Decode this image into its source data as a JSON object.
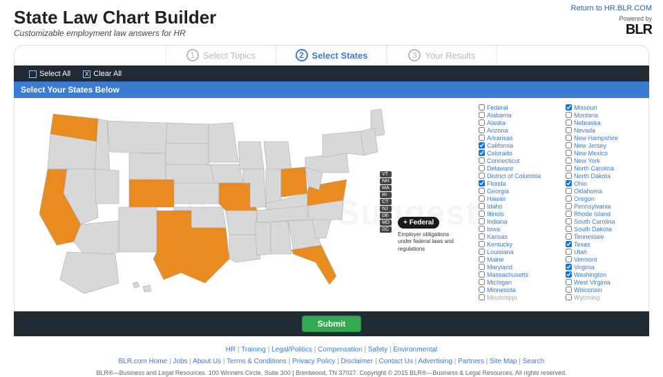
{
  "header": {
    "title": "State Law Chart Builder",
    "subtitle": "Customizable employment law answers for HR",
    "return_link": "Return to HR.BLR.COM",
    "powered_by": "Powered by",
    "brand": "BLR"
  },
  "steps": {
    "s1": {
      "num": "1",
      "label": "Select Topics"
    },
    "s2": {
      "num": "2",
      "label": "Select States"
    },
    "s3": {
      "num": "3",
      "label": "Your Results"
    }
  },
  "toolbar": {
    "select_all": "Select All",
    "clear_all": "Clear All"
  },
  "section_title": "Select Your States Below",
  "federal": {
    "pill": "+ Federal",
    "desc": "Employer obligations under federal laws and regulations"
  },
  "small_state_labels": [
    "VT",
    "NH",
    "MA",
    "RI",
    "CT",
    "NJ",
    "DE",
    "MD",
    "DC"
  ],
  "states_col1": [
    {
      "label": "Federal",
      "checked": false
    },
    {
      "label": "Alabama",
      "checked": false
    },
    {
      "label": "Alaska",
      "checked": false
    },
    {
      "label": "Arizona",
      "checked": false
    },
    {
      "label": "Arkansas",
      "checked": false
    },
    {
      "label": "California",
      "checked": true
    },
    {
      "label": "Colorado",
      "checked": true
    },
    {
      "label": "Connecticut",
      "checked": false
    },
    {
      "label": "Delaware",
      "checked": false
    },
    {
      "label": "District of Columbia",
      "checked": false
    },
    {
      "label": "Florida",
      "checked": true
    },
    {
      "label": "Georgia",
      "checked": false
    },
    {
      "label": "Hawaii",
      "checked": false
    },
    {
      "label": "Idaho",
      "checked": false
    },
    {
      "label": "Illinois",
      "checked": false
    },
    {
      "label": "Indiana",
      "checked": false
    },
    {
      "label": "Iowa",
      "checked": false
    },
    {
      "label": "Kansas",
      "checked": false
    },
    {
      "label": "Kentucky",
      "checked": false
    },
    {
      "label": "Louisiana",
      "checked": false
    },
    {
      "label": "Maine",
      "checked": false
    },
    {
      "label": "Maryland",
      "checked": false
    },
    {
      "label": "Massachusetts",
      "checked": false
    },
    {
      "label": "Michigan",
      "checked": false
    },
    {
      "label": "Minnesota",
      "checked": false
    },
    {
      "label": "Mississippi",
      "checked": false,
      "muted": true
    }
  ],
  "states_col2": [
    {
      "label": "Missouri",
      "checked": true
    },
    {
      "label": "Montana",
      "checked": false
    },
    {
      "label": "Nebraska",
      "checked": false
    },
    {
      "label": "Nevada",
      "checked": false
    },
    {
      "label": "New Hampshire",
      "checked": false
    },
    {
      "label": "New Jersey",
      "checked": false
    },
    {
      "label": "New Mexico",
      "checked": false
    },
    {
      "label": "New York",
      "checked": false
    },
    {
      "label": "North Carolina",
      "checked": false
    },
    {
      "label": "North Dakota",
      "checked": false
    },
    {
      "label": "Ohio",
      "checked": true
    },
    {
      "label": "Oklahoma",
      "checked": false
    },
    {
      "label": "Oregon",
      "checked": false
    },
    {
      "label": "Pennsylvania",
      "checked": false
    },
    {
      "label": "Rhode Island",
      "checked": false
    },
    {
      "label": "South Carolina",
      "checked": false
    },
    {
      "label": "South Dakota",
      "checked": false
    },
    {
      "label": "Tennessee",
      "checked": false
    },
    {
      "label": "Texas",
      "checked": true
    },
    {
      "label": "Utah",
      "checked": false
    },
    {
      "label": "Vermont",
      "checked": false
    },
    {
      "label": "Virginia",
      "checked": true
    },
    {
      "label": "Washington",
      "checked": true
    },
    {
      "label": "West Virginia",
      "checked": false
    },
    {
      "label": "Wisconsin",
      "checked": false
    },
    {
      "label": "Wyoming",
      "checked": false,
      "muted": true
    }
  ],
  "submit_label": "Submit",
  "footer": {
    "row1": [
      "HR",
      "Training",
      "Legal/Politics",
      "Compensation",
      "Safety",
      "Environmental"
    ],
    "row2": [
      "BLR.com Home",
      "Jobs",
      "About Us",
      "Terms & Conditions",
      "Privacy Policy",
      "Disclaimer",
      "Contact Us",
      "Advertising",
      "Partners",
      "Site Map",
      "Search"
    ],
    "copyright": "BLR®—Business and Legal Resources. 100 Winners Circle, Suite 300 | Brentwood, TN 37027. Copyright © 2015 BLR®—Business & Legal Resources. All rights reserved."
  },
  "watermark": "SoftwareSuggest"
}
